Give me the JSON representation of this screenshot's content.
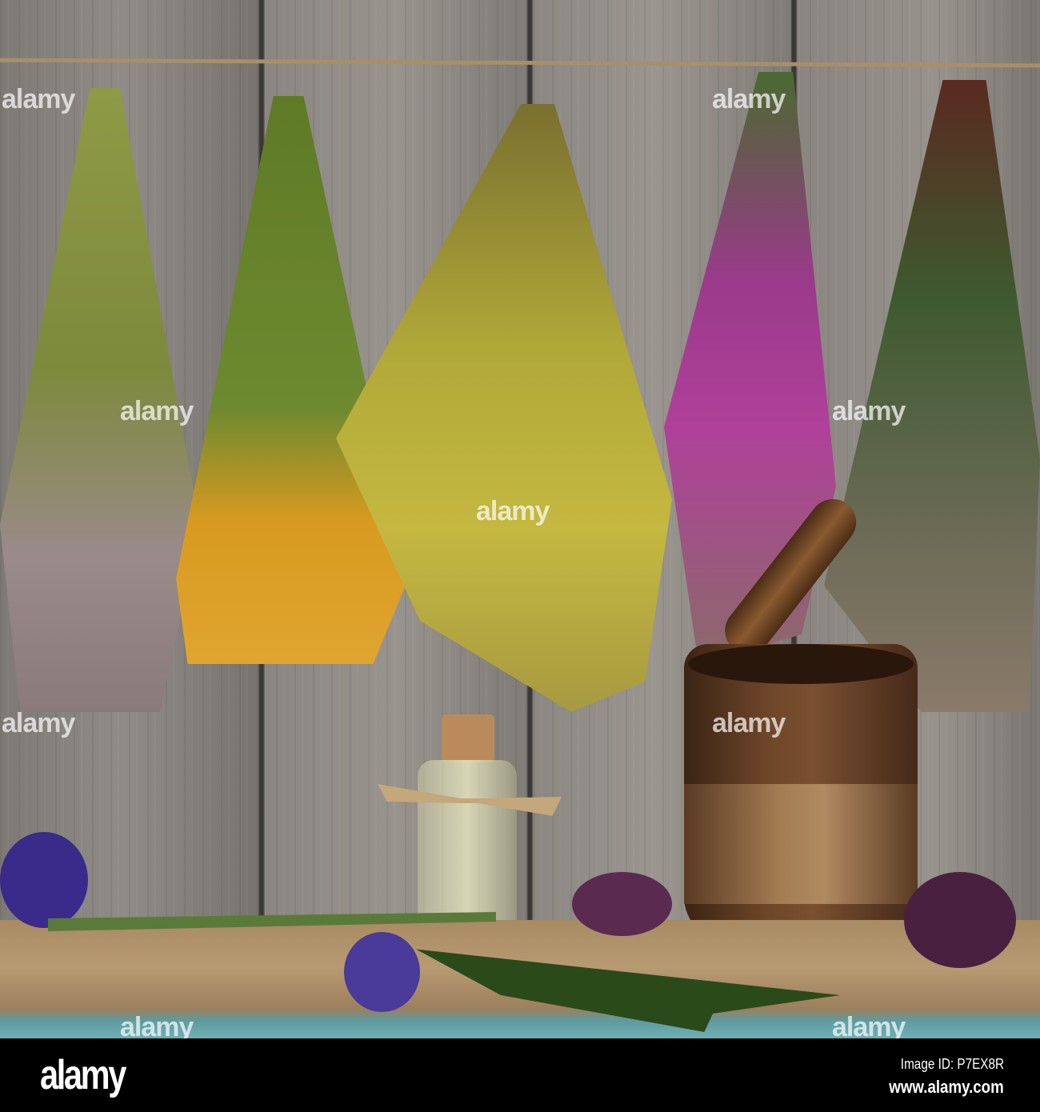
{
  "watermark": {
    "text": "alamy"
  },
  "footer": {
    "logo": "alamy",
    "image_id": "Image ID: P7EX8R",
    "url": "www.alamy.com"
  },
  "colors": {
    "wood": "#8a8580",
    "shelf": "#a88a63",
    "footer": "#000000"
  }
}
